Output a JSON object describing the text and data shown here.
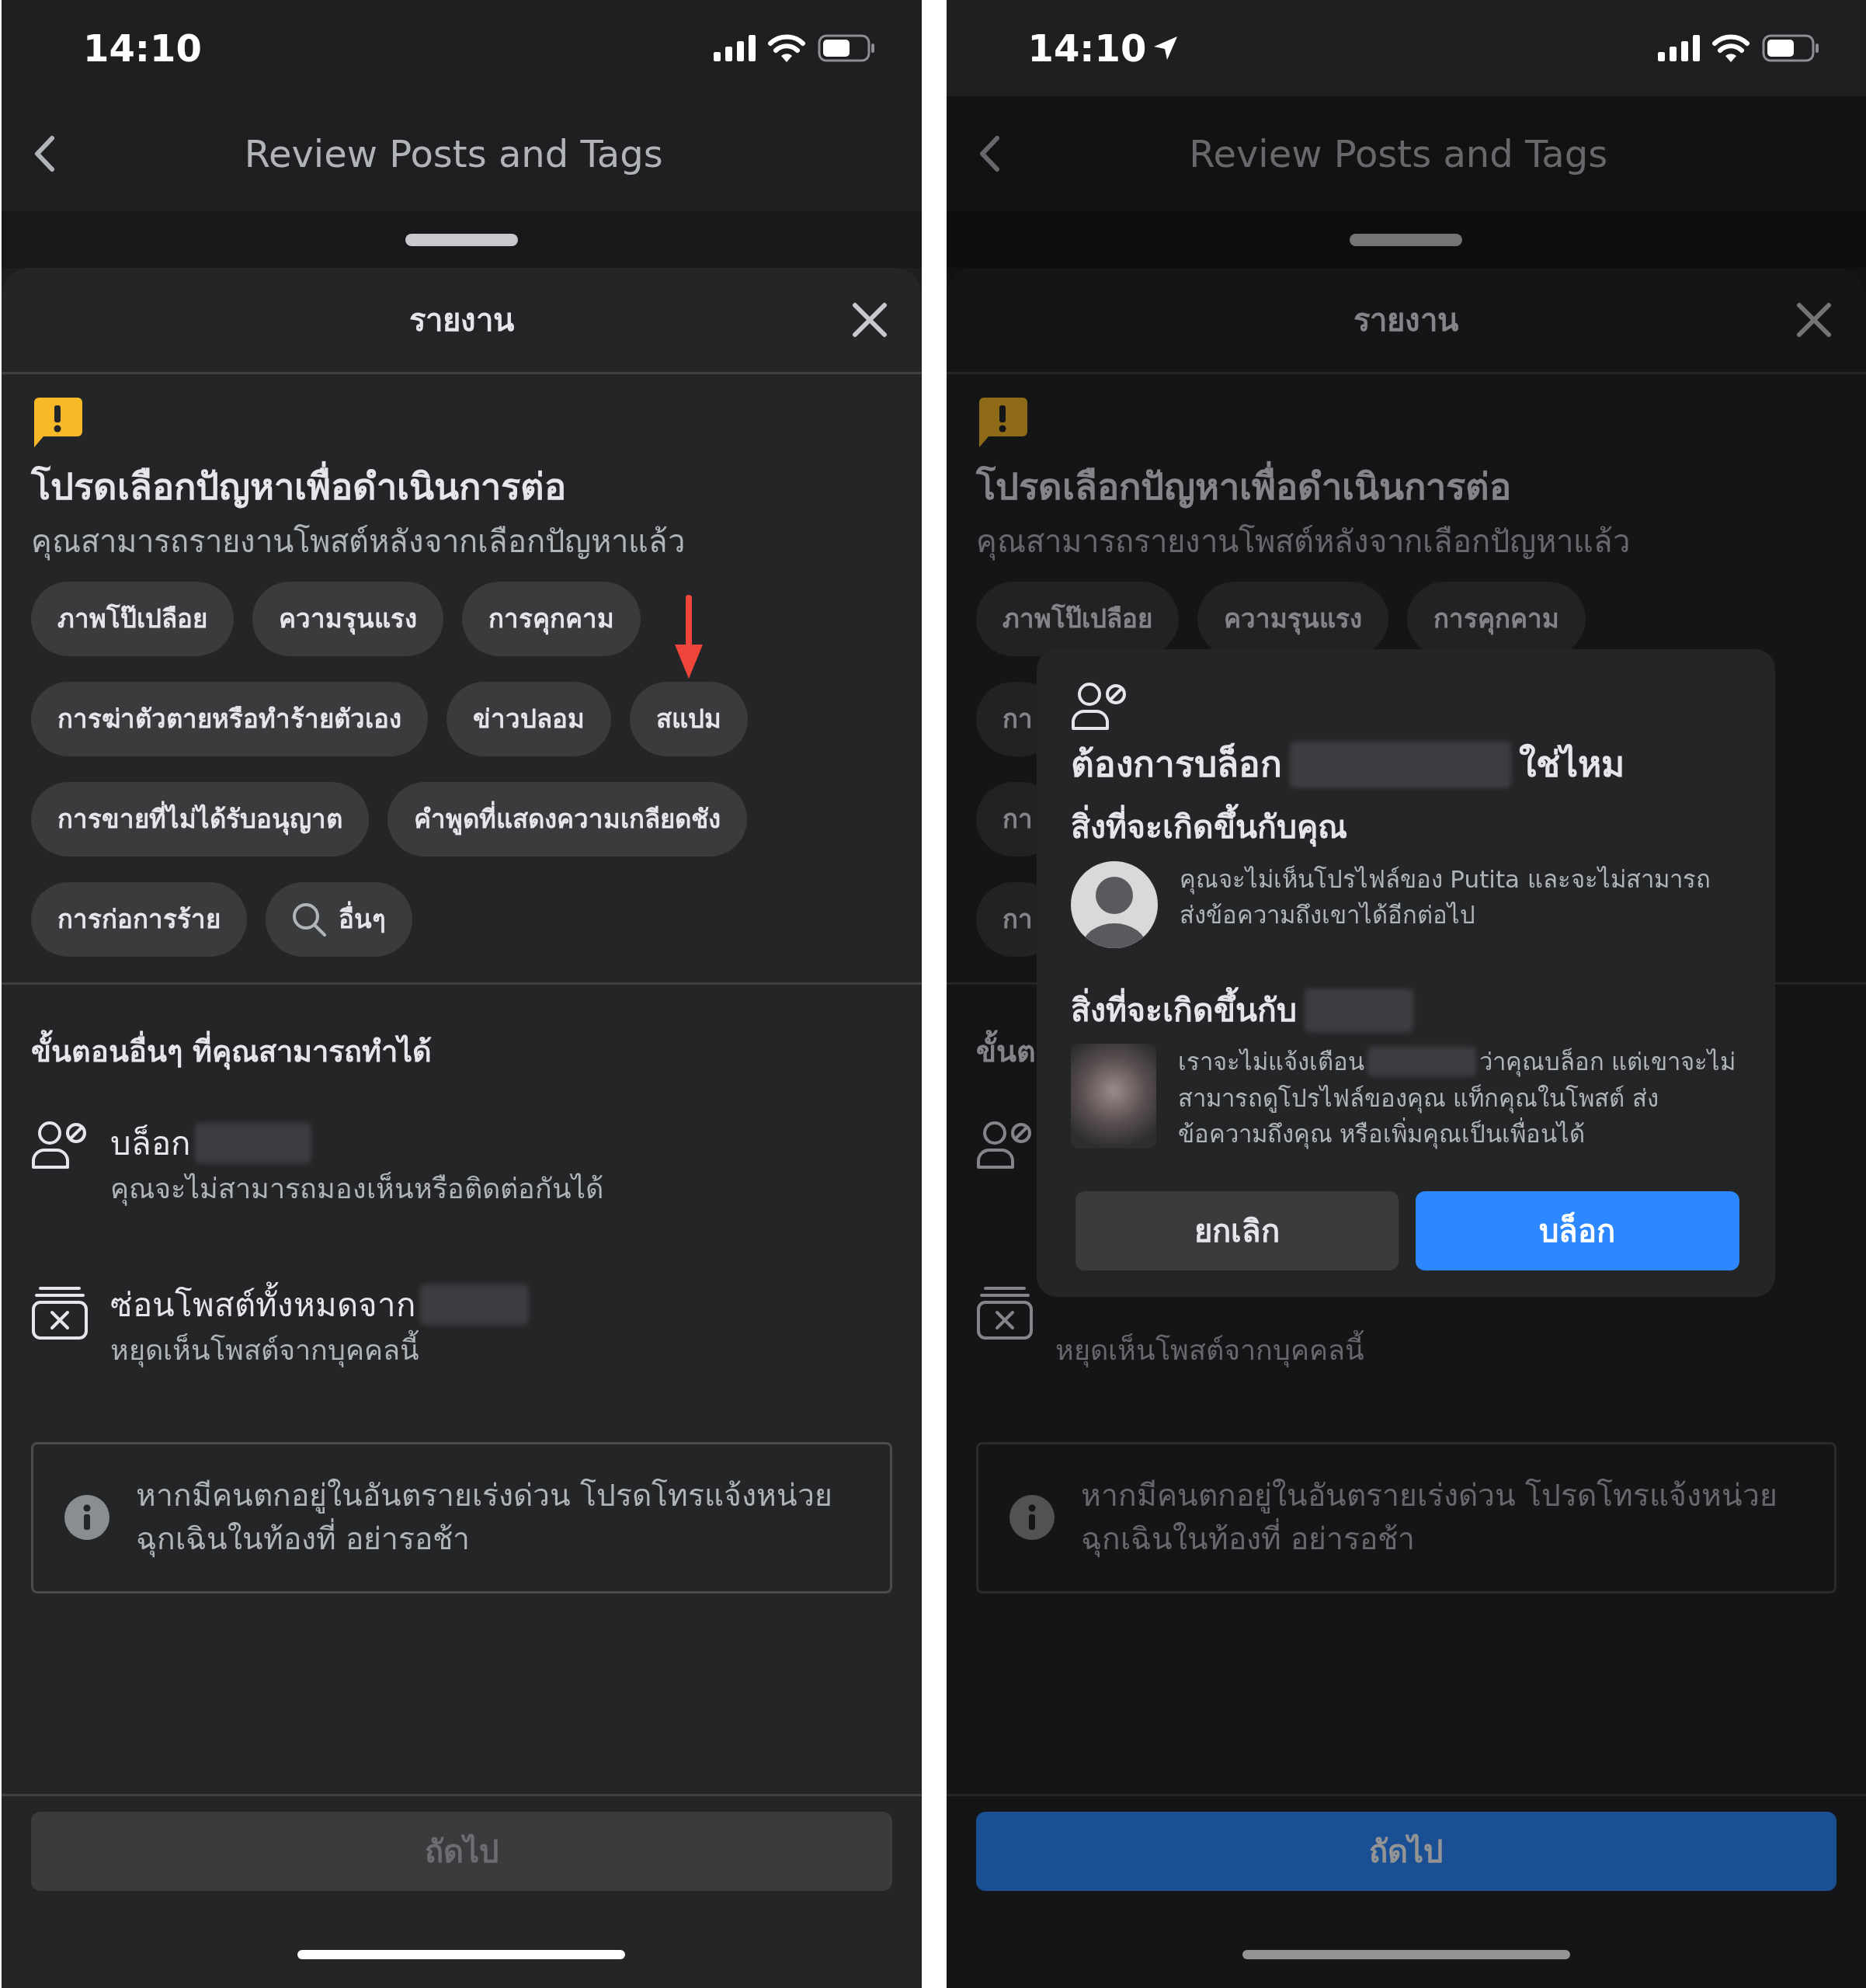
{
  "screens": [
    {
      "status_bar": {
        "time": "14:10",
        "location": false
      },
      "header": {
        "title": "Review Posts and Tags"
      },
      "dimmed": false,
      "sheet": {
        "title": "รายงาน",
        "heading": "โปรดเลือกปัญหาเพื่อดำเนินการต่อ",
        "subtitle": "คุณสามารถรายงานโพสต์หลังจากเลือกปัญหาแล้ว",
        "chip_rows": [
          [
            {
              "kind": "topic",
              "label": "ภาพโป๊เปลือย",
              "marked": false
            },
            {
              "kind": "topic",
              "label": "ความรุนแรง",
              "marked": false
            },
            {
              "kind": "topic",
              "label": "การคุกคาม",
              "marked": false
            }
          ],
          [
            {
              "kind": "topic",
              "label": "การฆ่าตัวตายหรือทำร้ายตัวเอง",
              "marked": false
            },
            {
              "kind": "topic",
              "label": "ข่าวปลอม",
              "marked": false
            },
            {
              "kind": "topic",
              "label": "สแปม",
              "marked": true
            }
          ],
          [
            {
              "kind": "topic",
              "label": "การขายที่ไม่ได้รับอนุญาต",
              "marked": false
            },
            {
              "kind": "topic",
              "label": "คำพูดที่แสดงความเกลียดชัง",
              "marked": false
            }
          ],
          [
            {
              "kind": "topic",
              "label": "การก่อการร้าย",
              "marked": false
            },
            {
              "kind": "search",
              "label": "อื่นๆ",
              "marked": false
            }
          ]
        ],
        "other_steps": {
          "heading": "ขั้นตอนอื่นๆ ที่คุณสามารถทำได้",
          "options": [
            {
              "kind": "block",
              "title": "บล็อก",
              "redacted": true,
              "subtitle": "คุณจะไม่สามารถมองเห็นหรือติดต่อกันได้"
            },
            {
              "kind": "hide",
              "title": "ซ่อนโพสต์ทั้งหมดจาก",
              "redacted": true,
              "subtitle": "หยุดเห็นโพสต์จากบุคคลนี้"
            }
          ]
        },
        "notice": "หากมีคนตกอยู่ในอันตรายเร่งด่วน โปรดโทรแจ้งหน่วยฉุกเฉินในท้องที่ อย่ารอช้า",
        "next_button": {
          "label": "ถัดไป",
          "disabled": true
        }
      }
    },
    {
      "status_bar": {
        "time": "14:10",
        "location": true
      },
      "header": {
        "title": "Review Posts and Tags"
      },
      "dimmed": true,
      "sheet": {
        "title": "รายงาน",
        "heading": "โปรดเลือกปัญหาเพื่อดำเนินการต่อ",
        "subtitle": "คุณสามารถรายงานโพสต์หลังจากเลือกปัญหาแล้ว",
        "chip_rows": [
          [
            {
              "kind": "topic",
              "label": "ภาพโป๊เปลือย",
              "marked": false
            },
            {
              "kind": "topic",
              "label": "ความรุนแรง",
              "marked": false
            },
            {
              "kind": "topic",
              "label": "การคุกคาม",
              "marked": false
            }
          ],
          [
            {
              "kind": "topic",
              "label": "กา",
              "marked": false
            }
          ],
          [
            {
              "kind": "topic",
              "label": "กา",
              "marked": false
            }
          ],
          [
            {
              "kind": "topic",
              "label": "กา",
              "marked": false
            }
          ]
        ],
        "other_steps": {
          "heading": "ขั้นต",
          "options": [
            {
              "kind": "block",
              "redacted": false
            },
            {
              "kind": "hide",
              "redacted": false,
              "subtitle": "หยุดเห็นโพสต์จากบุคคลนี้"
            }
          ]
        },
        "notice": "หากมีคนตกอยู่ในอันตรายเร่งด่วน โปรดโทรแจ้งหน่วยฉุกเฉินในท้องที่ อย่ารอช้า",
        "next_button": {
          "label": "ถัดไป",
          "disabled": false
        }
      },
      "dialog": {
        "title_before": "ต้องการบล็อก",
        "title_redacted": true,
        "title_after": "ใช่ไหม",
        "sections": [
          {
            "heading": "สิ่งที่จะเกิดขึ้นกับคุณ",
            "heading_redacted": false,
            "avatar_blurred": false,
            "lines": [
              [
                {
                  "kind": "text",
                  "text": "คุณจะไม่เห็นโปรไฟล์ของ Putita และจะไม่สามารถ"
                }
              ],
              [
                {
                  "kind": "text",
                  "text": "ส่งข้อความถึงเขาได้อีกต่อไป"
                }
              ]
            ]
          },
          {
            "heading": "สิ่งที่จะเกิดขึ้นกับ",
            "heading_redacted": true,
            "avatar_blurred": true,
            "lines": [
              [
                {
                  "kind": "text",
                  "text": "เราจะไม่แจ้งเตือน"
                },
                {
                  "kind": "redacted"
                },
                {
                  "kind": "text",
                  "text": "ว่าคุณบล็อก แต่เขาจะไม่"
                }
              ],
              [
                {
                  "kind": "text",
                  "text": "สามารถดูโปรไฟล์ของคุณ แท็กคุณในโพสต์ ส่ง"
                }
              ],
              [
                {
                  "kind": "text",
                  "text": "ข้อความถึงคุณ หรือเพิ่มคุณเป็นเพื่อนได้"
                }
              ]
            ]
          }
        ],
        "buttons": [
          {
            "kind": "secondary",
            "label": "ยกเลิก"
          },
          {
            "kind": "primary",
            "label": "บล็อก"
          }
        ]
      }
    }
  ]
}
